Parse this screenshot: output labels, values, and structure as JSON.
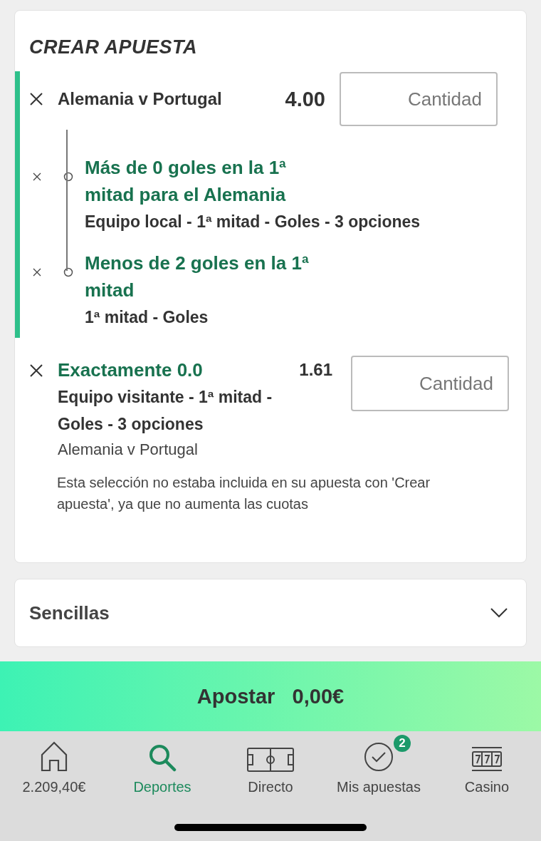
{
  "title": "CREAR APUESTA",
  "builder": {
    "event": "Alemania v Portugal",
    "odds": "4.00",
    "stake": {
      "placeholder": "Cantidad"
    },
    "legs": [
      {
        "selection": "Más de 0 goles en la 1ª mitad para el Alemania",
        "market": "Equipo local - 1ª mitad - Goles - 3 opciones"
      },
      {
        "selection": "Menos de 2 goles en la 1ª mitad",
        "market": "1ª mitad - Goles"
      }
    ]
  },
  "excluded": {
    "selection": "Exactamente 0.0",
    "odds": "1.61",
    "market": "Equipo visitante - 1ª mitad - Goles - 3 opciones",
    "event": "Alemania v Portugal",
    "stake": {
      "placeholder": "Cantidad"
    },
    "note": "Esta selección no estaba incluida en su apuesta con 'Crear apuesta', ya que no aumenta las cuotas"
  },
  "singles": {
    "label": "Sencillas",
    "expanded": false
  },
  "bet_button": {
    "label": "Apostar",
    "amount": "0,00€"
  },
  "nav": [
    {
      "label": "2.209,40€",
      "kind": "home",
      "selected": false
    },
    {
      "label": "Deportes",
      "kind": "search",
      "selected": true
    },
    {
      "label": "Directo",
      "kind": "pitch",
      "selected": false
    },
    {
      "label": "Mis apuestas",
      "kind": "check",
      "selected": false,
      "badge": "2"
    },
    {
      "label": "Casino",
      "kind": "slots",
      "selected": false
    }
  ]
}
